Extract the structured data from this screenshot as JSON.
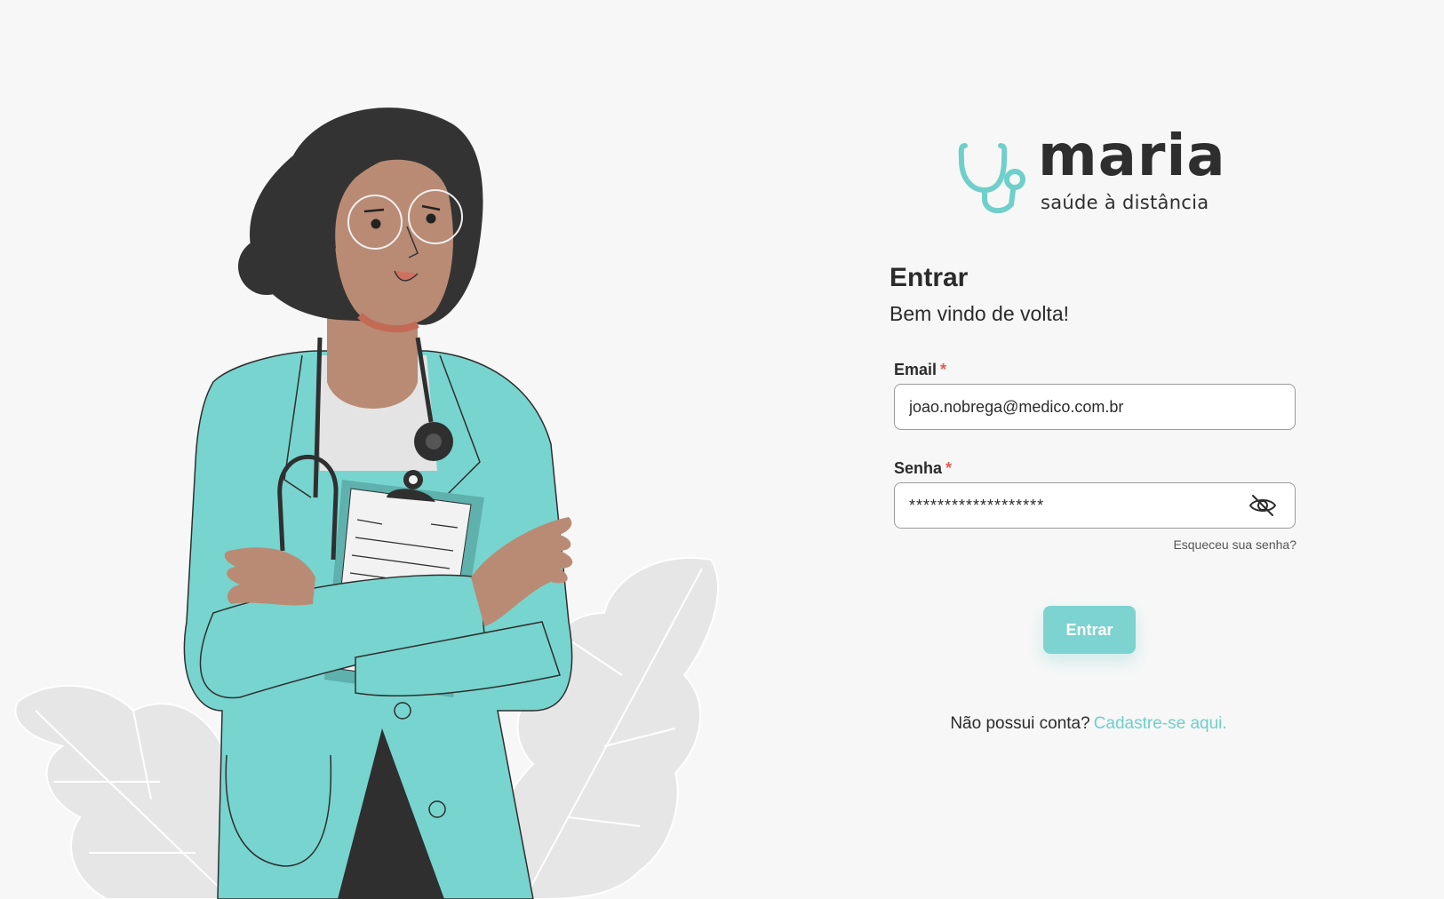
{
  "brand": {
    "name": "maria",
    "tagline": "saúde à distância",
    "accent_color": "#6fcfca"
  },
  "form": {
    "title": "Entrar",
    "subtitle": "Bem vindo de volta!",
    "email": {
      "label": "Email",
      "required_marker": "*",
      "value": "joao.nobrega@medico.com.br"
    },
    "password": {
      "label": "Senha",
      "required_marker": "*",
      "value": "*******************",
      "toggle_icon": "eye-off-icon"
    },
    "forgot_link": "Esqueceu sua senha?",
    "submit_label": "Entrar",
    "signup_prompt": "Não possui conta?",
    "signup_link": "Cadastre-se aqui."
  },
  "illustration": {
    "subject": "doctor-illustration"
  }
}
